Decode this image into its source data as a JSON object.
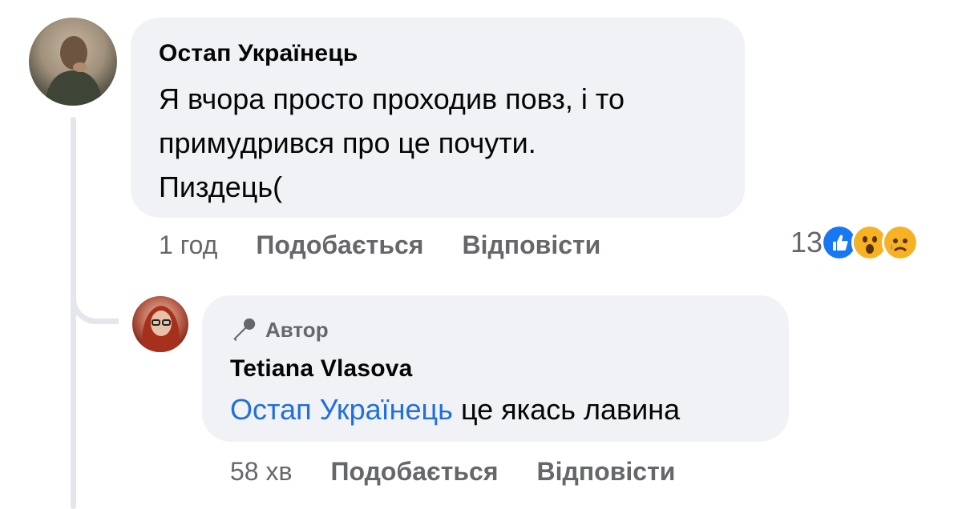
{
  "comment": {
    "author": "Остап Українець",
    "text": "Я вчора просто проходив повз, і то\nпримудрився про це почути.\nПиздець(",
    "time": "1 год",
    "like_label": "Подобається",
    "reply_label": "Відповісти",
    "reaction_count": "13",
    "reactions": [
      "like-icon",
      "wow-icon",
      "sad-icon"
    ]
  },
  "reply": {
    "badge": "Автор",
    "author": "Tetiana Vlasova",
    "mention": "Остап Українець",
    "text": " це якась лавина",
    "time": "58 хв",
    "like_label": "Подобається",
    "reply_label": "Відповісти"
  },
  "colors": {
    "bubble": "#f0f2f5",
    "mention": "#216fdb",
    "meta": "#65676b",
    "like_blue": "#1877f2"
  }
}
